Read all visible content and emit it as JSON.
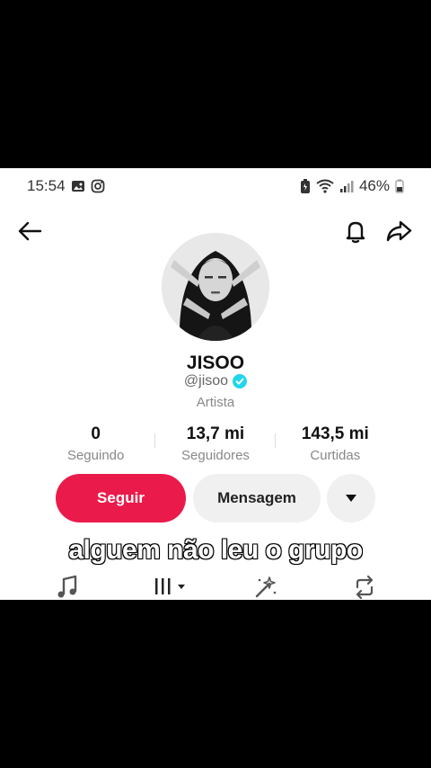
{
  "status_bar": {
    "time": "15:54",
    "battery": "46%"
  },
  "profile": {
    "display_name": "JISOO",
    "handle": "@jisoo",
    "category": "Artista",
    "verified": true
  },
  "stats": [
    {
      "value": "0",
      "label": "Seguindo"
    },
    {
      "value": "13,7 mi",
      "label": "Seguidores"
    },
    {
      "value": "143,5 mi",
      "label": "Curtidas"
    }
  ],
  "actions": {
    "follow": "Seguir",
    "message": "Mensagem"
  },
  "caption": "alguem não leu o grupo",
  "colors": {
    "accent": "#ea1b4b",
    "verified": "#20d5ec"
  },
  "icons": [
    "back-arrow-icon",
    "bell-icon",
    "share-icon",
    "music-note-icon",
    "grid-icon",
    "sparkle-icon",
    "repost-icon"
  ]
}
